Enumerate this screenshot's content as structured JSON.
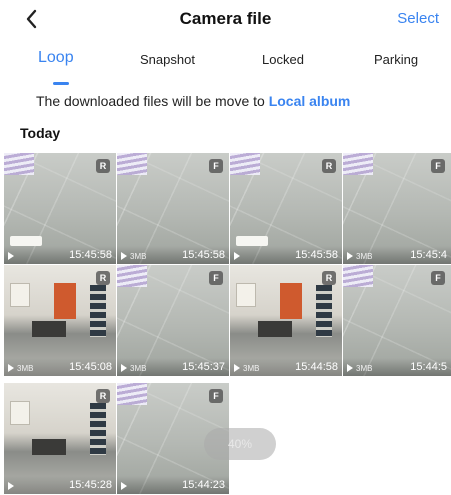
{
  "header": {
    "title": "Camera file",
    "select_label": "Select",
    "back_icon": "chevron-left-icon"
  },
  "tabs": [
    {
      "label": "Loop",
      "active": true
    },
    {
      "label": "Snapshot",
      "active": false
    },
    {
      "label": "Locked",
      "active": false
    },
    {
      "label": "Parking",
      "active": false
    }
  ],
  "notice": {
    "text": "The downloaded files will be move to ",
    "link": "Local album"
  },
  "section": {
    "title": "Today"
  },
  "thumbnails": [
    {
      "badge": "R",
      "size": "",
      "time": "15:45:58",
      "scene": "ceiling"
    },
    {
      "badge": "F",
      "size": "3MB",
      "time": "15:45:58",
      "scene": "ceiling"
    },
    {
      "badge": "R",
      "size": "",
      "time": "15:45:58",
      "scene": "ceiling"
    },
    {
      "badge": "F",
      "size": "3MB",
      "time": "15:45:4",
      "scene": "ceiling"
    },
    {
      "badge": "R",
      "size": "3MB",
      "time": "15:45:08",
      "scene": "office"
    },
    {
      "badge": "F",
      "size": "3MB",
      "time": "15:45:37",
      "scene": "ceiling"
    },
    {
      "badge": "R",
      "size": "3MB",
      "time": "15:44:58",
      "scene": "office"
    },
    {
      "badge": "F",
      "size": "3MB",
      "time": "15:44:5",
      "scene": "ceiling"
    },
    {
      "badge": "R",
      "size": "",
      "time": "15:45:28",
      "scene": "office"
    },
    {
      "badge": "F",
      "size": "",
      "time": "15:44:23",
      "scene": "ceiling"
    }
  ],
  "progress": {
    "label": "40%",
    "value": 0.4
  },
  "colors": {
    "accent": "#3a84f0",
    "badge_bg": "#505050"
  }
}
